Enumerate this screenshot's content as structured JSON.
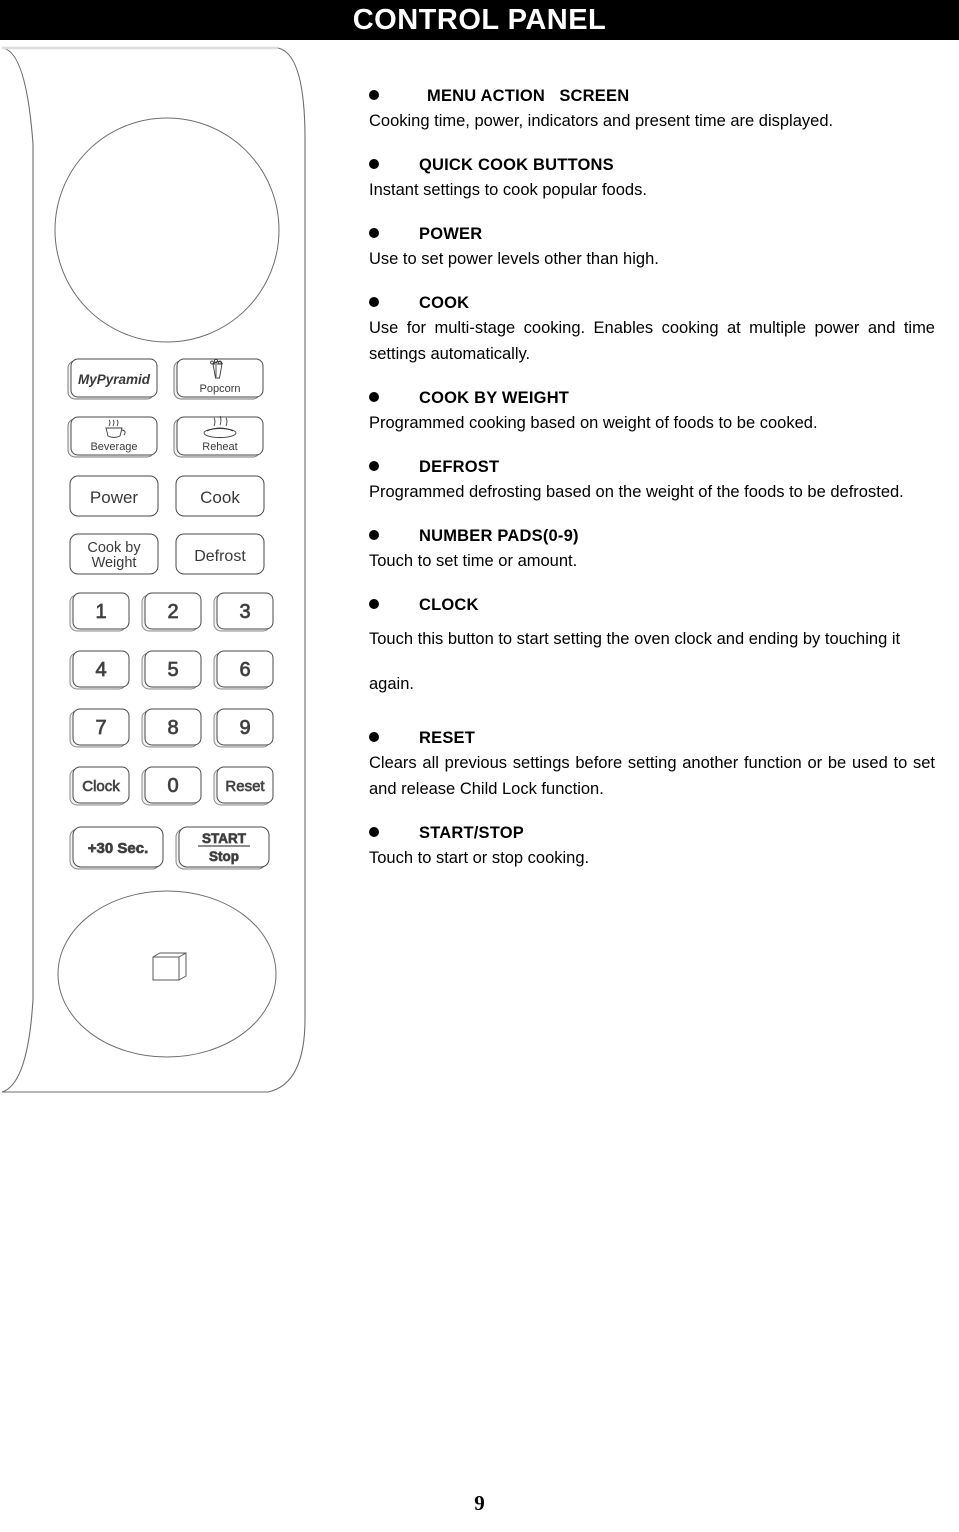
{
  "header": {
    "title": "CONTROL PANEL"
  },
  "control_panel": {
    "display_label": "menu-action-screen-circle",
    "door_handle_label": "door-handle-ellipse",
    "buttons": [
      {
        "id": "mypyramid",
        "label": "MyPyramid",
        "icon": "none"
      },
      {
        "id": "popcorn",
        "label": "Popcorn",
        "icon": "popcorn-bag-icon"
      },
      {
        "id": "beverage",
        "label": "Beverage",
        "icon": "steaming-cup-icon"
      },
      {
        "id": "reheat",
        "label": "Reheat",
        "icon": "steaming-plate-icon"
      },
      {
        "id": "power",
        "label": "Power",
        "icon": "none"
      },
      {
        "id": "cook",
        "label": "Cook",
        "icon": "none"
      },
      {
        "id": "cook-by-weight",
        "label_line1": "Cook by",
        "label_line2": "Weight",
        "icon": "none"
      },
      {
        "id": "defrost",
        "label": "Defrost",
        "icon": "none"
      }
    ],
    "keypad": [
      {
        "id": "num-1",
        "label": "1"
      },
      {
        "id": "num-2",
        "label": "2"
      },
      {
        "id": "num-3",
        "label": "3"
      },
      {
        "id": "num-4",
        "label": "4"
      },
      {
        "id": "num-5",
        "label": "5"
      },
      {
        "id": "num-6",
        "label": "6"
      },
      {
        "id": "num-7",
        "label": "7"
      },
      {
        "id": "num-8",
        "label": "8"
      },
      {
        "id": "num-9",
        "label": "9"
      },
      {
        "id": "clock",
        "label": "Clock"
      },
      {
        "id": "num-0",
        "label": "0"
      },
      {
        "id": "reset",
        "label": "Reset"
      }
    ],
    "bottom_buttons": [
      {
        "id": "add-30-sec",
        "label": "+30 Sec."
      },
      {
        "id": "start-stop",
        "label_line1": "START",
        "label_line2": "Stop"
      }
    ]
  },
  "sections": [
    {
      "id": "menu-action-screen",
      "heading": "MENU ACTION   SCREEN",
      "body": "Cooking time, power, indicators and present time are displayed."
    },
    {
      "id": "quick-cook-buttons",
      "heading": "QUICK COOK BUTTONS",
      "body": "Instant settings to cook popular foods."
    },
    {
      "id": "power",
      "heading": "POWER",
      "body": "Use to set power levels other than high."
    },
    {
      "id": "cook",
      "heading": "COOK",
      "body": "Use for multi-stage cooking. Enables cooking at multiple power and time settings automatically."
    },
    {
      "id": "cook-by-weight",
      "heading": "COOK BY WEIGHT",
      "body": "Programmed cooking based on weight of foods to be cooked."
    },
    {
      "id": "defrost",
      "heading": "DEFROST",
      "body": "Programmed defrosting based on the weight of the foods to be defrosted."
    },
    {
      "id": "number-pads",
      "heading": "NUMBER PADS(0-9)",
      "body": "Touch to set time or amount."
    },
    {
      "id": "clock",
      "heading": "CLOCK",
      "body": "Touch this button to start setting the oven clock and ending by touching it again."
    },
    {
      "id": "reset",
      "heading": "RESET",
      "body": "Clears all previous settings before setting another function or be used to set and release Child Lock function."
    },
    {
      "id": "start-stop",
      "heading": "START/STOP",
      "body": "Touch to start or stop cooking."
    }
  ],
  "footer": {
    "page_number": "9"
  }
}
